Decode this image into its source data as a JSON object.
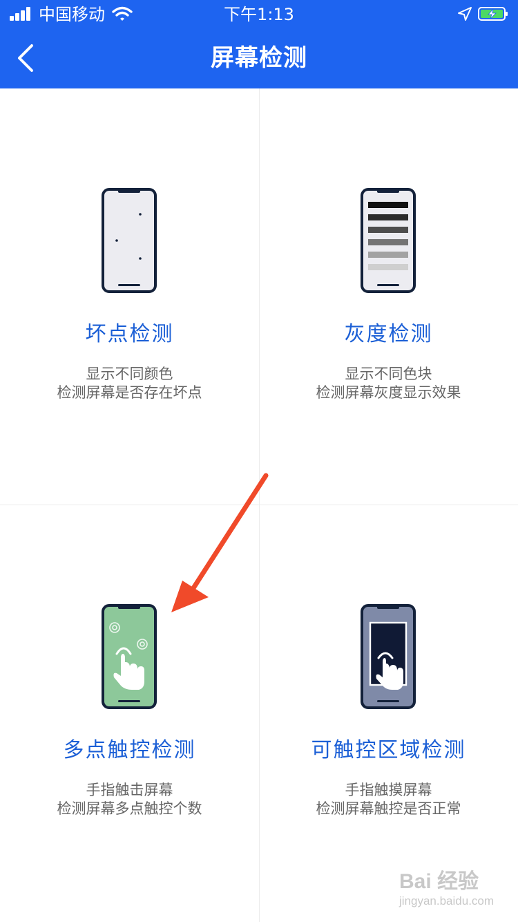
{
  "status_bar": {
    "carrier": "中国移动",
    "time": "下午1:13"
  },
  "nav": {
    "title": "屏幕检测",
    "back_icon": "chevron-left-icon"
  },
  "colors": {
    "header": "#1e64f0",
    "title_text": "#1b5fd6",
    "desc_text": "#666666",
    "arrow": "#f04a2a"
  },
  "tests": [
    {
      "title": "坏点检测",
      "desc_line1": "显示不同颜色",
      "desc_line2": "检测屏幕是否存在坏点",
      "icon": "phone-dead-pixel-icon"
    },
    {
      "title": "灰度检测",
      "desc_line1": "显示不同色块",
      "desc_line2": "检测屏幕灰度显示效果",
      "icon": "phone-grayscale-icon"
    },
    {
      "title": "多点触控检测",
      "desc_line1": "手指触击屏幕",
      "desc_line2": "检测屏幕多点触控个数",
      "icon": "phone-multitouch-icon"
    },
    {
      "title": "可触控区域检测",
      "desc_line1": "手指触摸屏幕",
      "desc_line2": "检测屏幕触控是否正常",
      "icon": "phone-touch-area-icon"
    }
  ],
  "watermark": {
    "main": "Bai 经验",
    "sub": "jingyan.baidu.com"
  }
}
